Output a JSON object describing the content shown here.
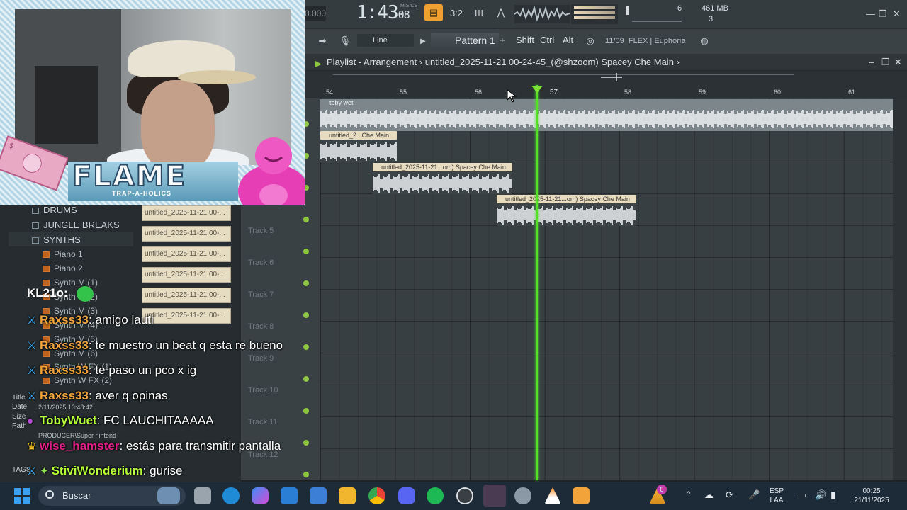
{
  "fl_toolbar": {
    "tempo": "0.000",
    "time_main": "1:43",
    "time_sub": "08",
    "time_unit": "M:S:CS",
    "memory": "461 MB",
    "cpu_value": "6",
    "voices": "3"
  },
  "fl_toolbar2": {
    "snap": "Line",
    "pattern": "Pattern 1",
    "plus": "+",
    "keys": [
      "Shift",
      "Ctrl",
      "Alt"
    ],
    "hint_date": "11/09",
    "hint_text": "FLEX | Euphoria"
  },
  "playlist": {
    "title": "Playlist - Arrangement",
    "separator": "›",
    "project": "untitled_2025-11-21 00-24-45_(@shzoom) Spacey Che Main",
    "ruler": [
      "54",
      "55",
      "56",
      "57",
      "58",
      "59",
      "60",
      "61"
    ],
    "tracks": [
      "Track 5",
      "Track 6",
      "Track 7",
      "Track 8",
      "Track 9",
      "Track 10",
      "Track 11",
      "Track 12"
    ],
    "clips": {
      "full": "toby wet",
      "clip1": "untitled_2...Che Main",
      "clip2": "untitled_2025-11-21...om) Spacey Che Main",
      "clip3": "untitled_2025-11-21...om) Spacey Che Main"
    }
  },
  "browser": {
    "folders": [
      "DRUMS",
      "JUNGLE BREAKS",
      "SYNTHS"
    ],
    "items": [
      "Piano 1",
      "Piano 2",
      "Synth M (1)",
      "Synth M (2)",
      "Synth M (3)",
      "Synth M (4)",
      "Synth M (5)",
      "Synth M (6)",
      "Synth W FX (1)",
      "Synth W FX (2)"
    ],
    "samples": [
      "untitled_2025-11-21 00-...",
      "untitled_2025-11-21 00-...",
      "untitled_2025-11-21 00-...",
      "untitled_2025-11-21 00-...",
      "untitled_2025-11-21 00-...",
      "untitled_2025-11-21 00-..."
    ],
    "info": {
      "title_label": "Title",
      "date_label": "Date",
      "date_value": "2/11/2025 13:48:42",
      "size_label": "Size",
      "path_label": "Path",
      "path_value": "PRODUCER\\Super nintend-",
      "tags_label": "TAGS"
    }
  },
  "overlay": {
    "brand": "FLAME",
    "brand_sub": "TRAP-A-HOLICS"
  },
  "chat": {
    "partial_user": "KL21o:",
    "messages": [
      {
        "user": "Raxss33",
        "text": ": amigo lauti",
        "color": "#f0a43c"
      },
      {
        "user": "Raxss33",
        "text": ": te muestro un beat q esta re bueno",
        "color": "#f0a43c"
      },
      {
        "user": "Raxss33",
        "text": ": te paso un pco x ig",
        "color": "#f0a43c"
      },
      {
        "user": "Raxss33",
        "text": ": aver q opinas",
        "color": "#f0a43c"
      },
      {
        "user": "TobyWuet",
        "text": ": FC LAUCHITAAAAA",
        "color": "#b7ff3a"
      },
      {
        "user": "wise_hamster",
        "text": ": estás para transmitir pantalla",
        "color": "#e0208a"
      },
      {
        "user": "StiviWonderium",
        "text": ": gurise",
        "color": "#b7ff3a"
      }
    ]
  },
  "taskbar": {
    "search_placeholder": "Buscar",
    "lang_top": "ESP",
    "lang_bottom": "LAA",
    "clock_time": "00:25",
    "clock_date": "21/11/2025",
    "notify_count": "8"
  },
  "colors": {
    "playhead": "#56e028",
    "clip": "#e7dcc0",
    "accent": "#f0a030",
    "track_dot": "#8ec63f"
  }
}
